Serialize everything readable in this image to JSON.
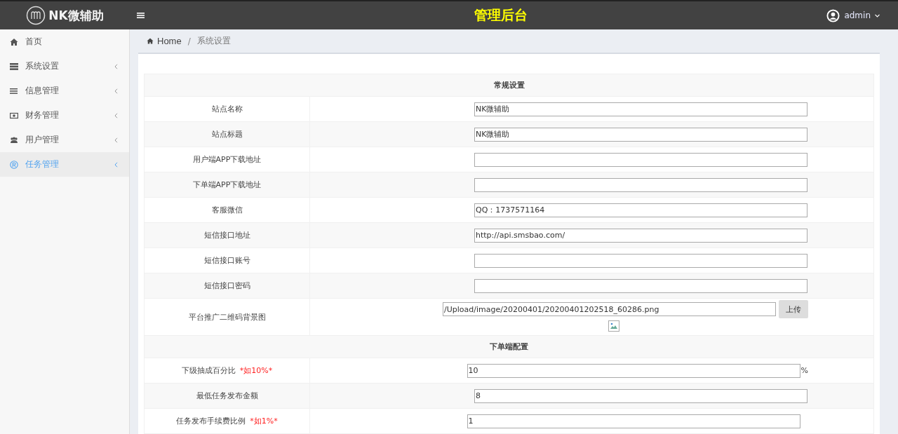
{
  "header": {
    "logo_text": "NK微辅助",
    "title": "管理后台",
    "user": "admin"
  },
  "sidebar": {
    "items": [
      {
        "label": "首页",
        "has_children": false,
        "selected": false
      },
      {
        "label": "系统设置",
        "has_children": true,
        "selected": false
      },
      {
        "label": "信息管理",
        "has_children": true,
        "selected": false
      },
      {
        "label": "财务管理",
        "has_children": true,
        "selected": false
      },
      {
        "label": "用户管理",
        "has_children": true,
        "selected": false
      },
      {
        "label": "任务管理",
        "has_children": true,
        "selected": true
      }
    ]
  },
  "breadcrumb": {
    "items": [
      "Home",
      "系统设置"
    ],
    "separator": "/"
  },
  "form": {
    "rows": [
      {
        "kind": "section",
        "label": "常规设置"
      },
      {
        "kind": "text",
        "label": "站点名称",
        "value": "NK微辅助"
      },
      {
        "kind": "text",
        "label": "站点标题",
        "value": "NK微辅助"
      },
      {
        "kind": "text",
        "label": "用户端APP下载地址",
        "value": ""
      },
      {
        "kind": "text",
        "label": "下单端APP下载地址",
        "value": ""
      },
      {
        "kind": "text",
        "label": "客服微信",
        "value": "QQ：1737571164"
      },
      {
        "kind": "text",
        "label": "短信接口地址",
        "value": "http://api.smsbao.com/"
      },
      {
        "kind": "text",
        "label": "短信接口账号",
        "value": ""
      },
      {
        "kind": "text",
        "label": "短信接口密码",
        "value": ""
      },
      {
        "kind": "upload",
        "label": "平台推广二维码背景图",
        "value": "/Upload/image/20200401/20200401202518_60286.png",
        "button": "上传"
      },
      {
        "kind": "section",
        "label": "下单端配置"
      },
      {
        "kind": "percent",
        "label": "下级抽成百分比",
        "hint": "*如10%*",
        "value": "10",
        "unit": "%"
      },
      {
        "kind": "text",
        "label": "最低任务发布金额",
        "value": "8"
      },
      {
        "kind": "percent",
        "label": "任务发布手续费比例",
        "hint": "*如1%*",
        "value": "1",
        "unit": ""
      }
    ]
  }
}
